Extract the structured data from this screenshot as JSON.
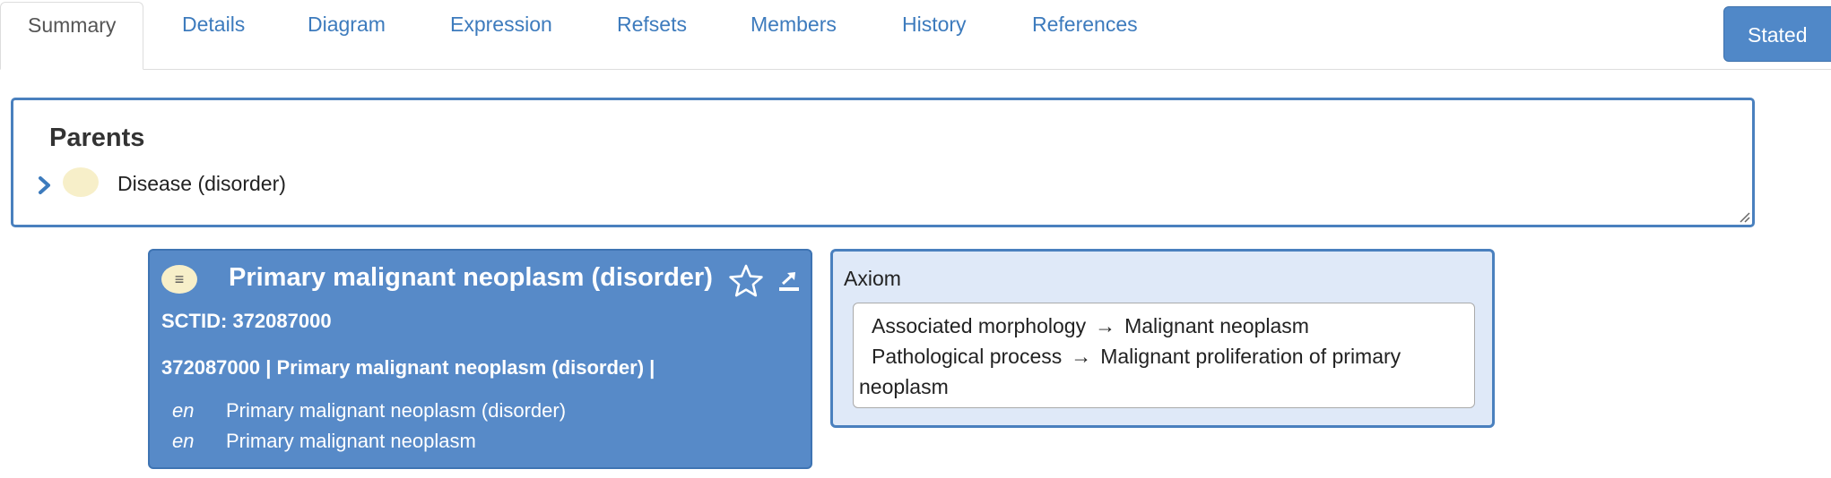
{
  "tabs": [
    {
      "label": "Summary",
      "active": true
    },
    {
      "label": "Details"
    },
    {
      "label": "Diagram"
    },
    {
      "label": "Expression"
    },
    {
      "label": "Refsets"
    },
    {
      "label": "Members"
    },
    {
      "label": "History"
    },
    {
      "label": "References"
    }
  ],
  "view_toggle": {
    "label": "Stated"
  },
  "parents": {
    "title": "Parents",
    "items": [
      {
        "label": "Disease (disorder)"
      }
    ]
  },
  "concept": {
    "icon_glyph": "≡",
    "title": "Primary malignant neoplasm (disorder)",
    "sctid_line": "SCTID: 372087000",
    "fsn_line": "372087000 | Primary malignant neoplasm (disorder) |",
    "descriptions": [
      {
        "lang": "en",
        "term": "Primary malignant neoplasm (disorder)"
      },
      {
        "lang": "en",
        "term": "Primary malignant neoplasm"
      }
    ]
  },
  "axiom": {
    "title": "Axiom",
    "arrow": "→",
    "relationships": [
      {
        "type": "Associated morphology",
        "target": "Malignant neoplasm"
      },
      {
        "type": "Pathological process",
        "target": "Malignant proliferation of primary neoplasm"
      }
    ]
  },
  "colors": {
    "accent": "#3d7bbd",
    "card_bg": "#578ac8",
    "axiom_bg": "#dfe9f8",
    "primitive_icon": "#f7efc9"
  }
}
